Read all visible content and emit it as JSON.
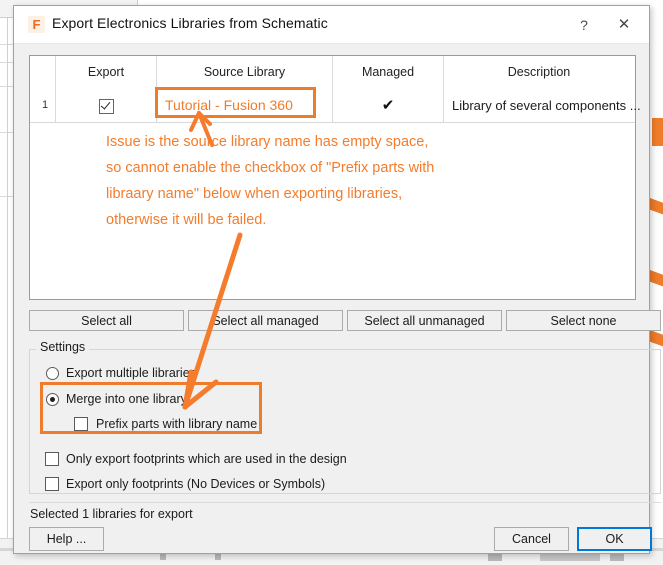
{
  "window": {
    "title": "Export Electronics Libraries from Schematic",
    "app_icon": "F",
    "app_icon_name": "fusion-logo-icon",
    "help_button": "?",
    "close_button": "✕"
  },
  "table": {
    "columns": [
      "Export",
      "Source Library",
      "Managed",
      "Description"
    ],
    "rows": [
      {
        "index": "1",
        "export_checked": true,
        "source_library": "Tutorial - Fusion 360",
        "managed": "✔",
        "description": "Library of several components ..."
      }
    ]
  },
  "select_buttons": [
    "Select all",
    "Select all managed",
    "Select all unmanaged",
    "Select none"
  ],
  "settings": {
    "legend": "Settings",
    "export_multiple_label": "Export multiple libraries",
    "merge_one_label": "Merge into one library",
    "prefix_parts_label": "Prefix parts with library name",
    "only_used_footprints_label": "Only export footprints which are used in the design",
    "only_footprints_label": "Export only footprints (No Devices or Symbols)"
  },
  "status": "Selected 1 libraries for export",
  "footer": {
    "help": "Help ...",
    "cancel": "Cancel",
    "ok": "OK"
  },
  "annotation": {
    "line1": "Issue is the source library name has empty space,",
    "line2": "so cannot enable the checkbox of \"Prefix parts with",
    "line3": "libraary name\" below when exporting libraries,",
    "line4": "otherwise it will be failed."
  },
  "colors": {
    "annotation_orange": "#f47c2c",
    "highlight_orange": "#ef7c2a",
    "focus_blue": "#0078d7",
    "dialog_bg": "#f0f0f0"
  }
}
